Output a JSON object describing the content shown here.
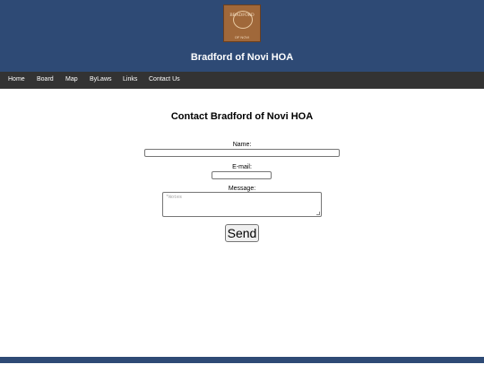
{
  "header": {
    "logo": {
      "text": "BRADFORD",
      "sub": "OF NOVI"
    },
    "title": "Bradford of Novi HOA"
  },
  "nav": {
    "items": [
      "Home",
      "Board",
      "Map",
      "ByLaws",
      "Links",
      "Contact Us"
    ]
  },
  "main": {
    "heading": "Contact Bradford of Novi HOA",
    "form": {
      "name_label": "Name:",
      "name_value": "",
      "email_label": "E-mail:",
      "email_value": "",
      "message_label": "Message:",
      "message_placeholder": "*Notes",
      "send_label": "Send"
    }
  },
  "footer": {
    "link": "facebook"
  },
  "colors": {
    "header_bg": "#2e4a75",
    "nav_bg": "#333333"
  }
}
